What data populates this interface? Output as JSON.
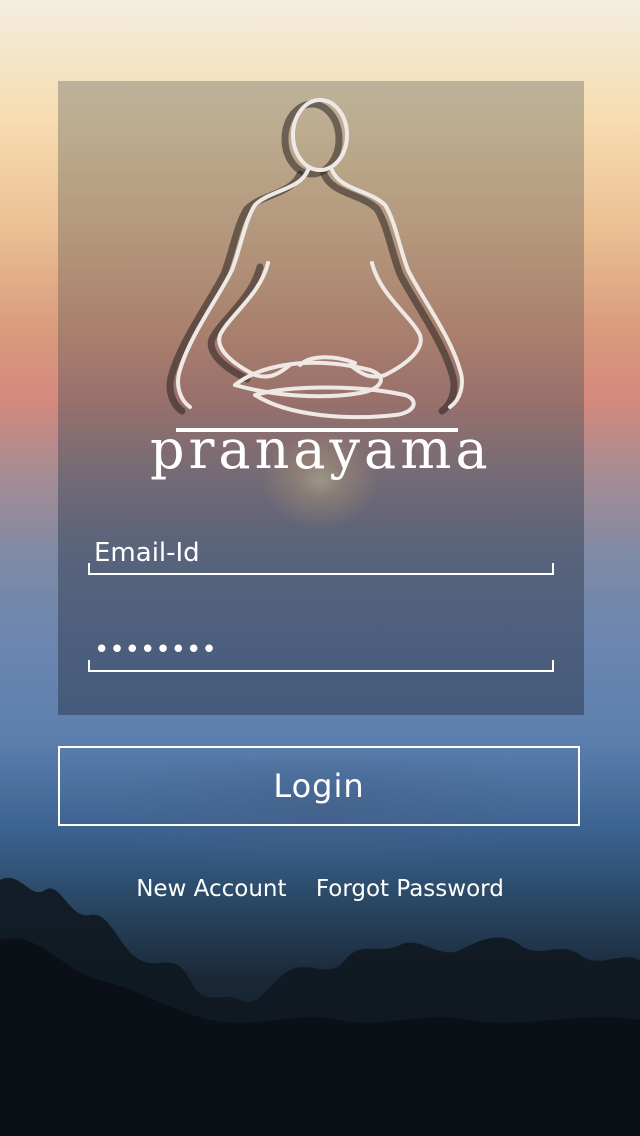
{
  "app": {
    "brand_name": "pranayama"
  },
  "form": {
    "email_placeholder": "Email-Id",
    "password_value": "********"
  },
  "actions": {
    "login_label": "Login",
    "new_account_label": "New Account",
    "forgot_password_label": "Forgot Password"
  },
  "colors": {
    "text": "#ffffff",
    "button_border": "#ffffff"
  }
}
